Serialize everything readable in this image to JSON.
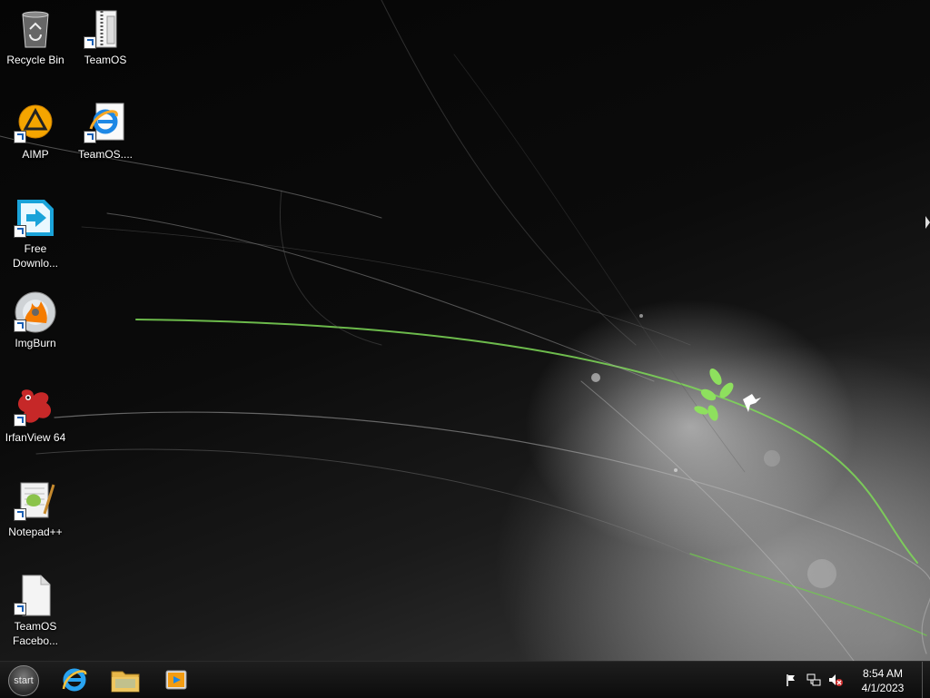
{
  "desktop_icons": [
    {
      "label": "Recycle Bin",
      "icon": "recycle-bin-icon",
      "shortcut": false
    },
    {
      "label": "TeamOS",
      "icon": "folder-zipper-icon",
      "shortcut": true
    },
    {
      "label": "AIMP",
      "icon": "aimp-icon",
      "shortcut": true
    },
    {
      "label": "TeamOS....",
      "icon": "internet-explorer-icon",
      "shortcut": true
    },
    {
      "label": "Free\nDownlo...",
      "icon": "free-download-manager-icon",
      "shortcut": true
    },
    {
      "label": "ImgBurn",
      "icon": "imgburn-disc-icon",
      "shortcut": true
    },
    {
      "label": "IrfanView 64",
      "icon": "irfanview-icon",
      "shortcut": true
    },
    {
      "label": "Notepad++",
      "icon": "notepad-plus-plus-icon",
      "shortcut": true
    },
    {
      "label": "TeamOS\nFacebo...",
      "icon": "blank-document-icon",
      "shortcut": true
    }
  ],
  "taskbar": {
    "start_label": "start",
    "pinned": [
      {
        "name": "internet-explorer",
        "icon": "internet-explorer-icon"
      },
      {
        "name": "file-explorer",
        "icon": "folder-icon"
      },
      {
        "name": "media-player",
        "icon": "media-player-icon"
      }
    ],
    "tray": [
      {
        "name": "action-center",
        "icon": "flag-icon"
      },
      {
        "name": "network",
        "icon": "network-icon"
      },
      {
        "name": "volume",
        "icon": "volume-muted-icon"
      }
    ],
    "time": "8:54 AM",
    "date": "4/1/2023"
  },
  "colors": {
    "wallpaper_accent": "#7ed957",
    "taskbar_bg": "#141414"
  }
}
